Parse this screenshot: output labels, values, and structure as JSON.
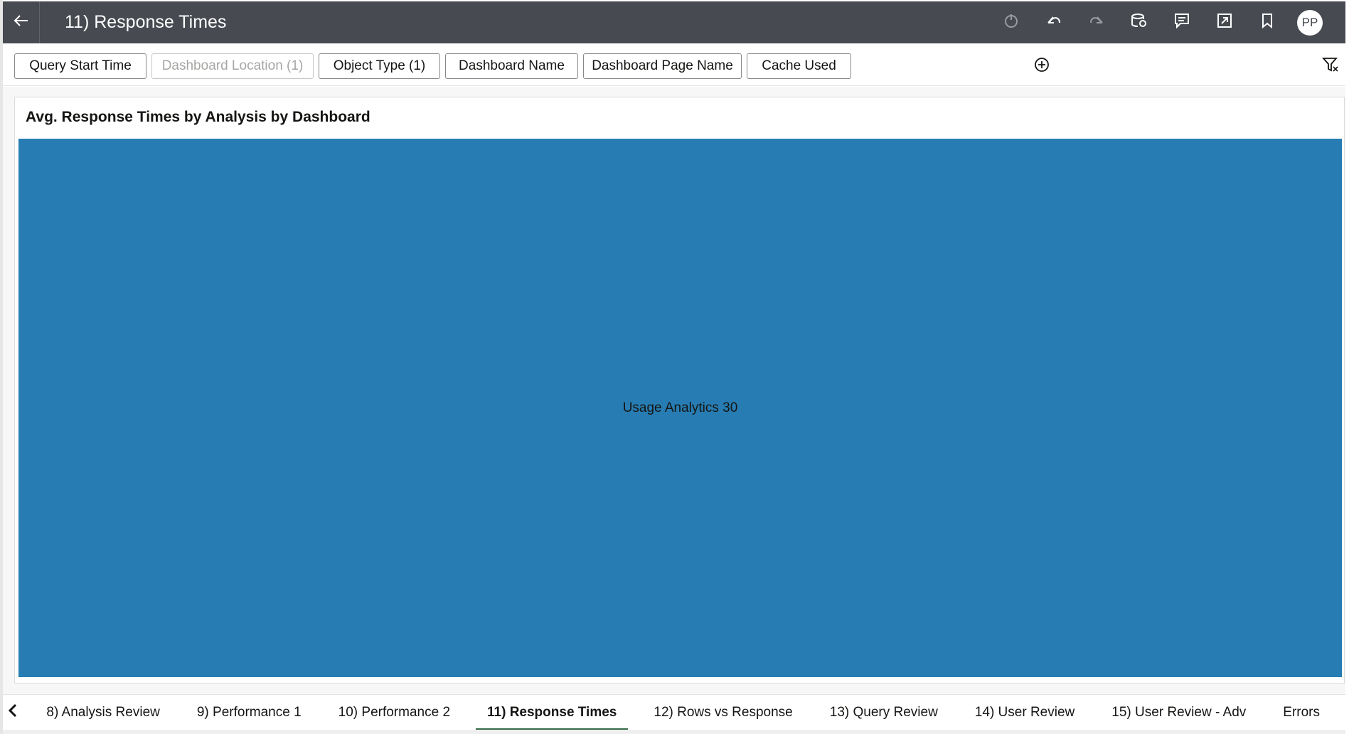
{
  "header": {
    "back_icon": "arrow-left-icon",
    "title": "11) Response Times",
    "actions": [
      {
        "name": "refresh-icon",
        "disabled": true
      },
      {
        "name": "undo-icon",
        "disabled": false
      },
      {
        "name": "redo-icon",
        "disabled": true
      },
      {
        "name": "data-refresh-icon",
        "disabled": false
      },
      {
        "name": "comments-icon",
        "disabled": false
      },
      {
        "name": "present-icon",
        "disabled": false
      },
      {
        "name": "bookmark-icon",
        "disabled": false
      }
    ],
    "avatar_initials": "PP"
  },
  "filters": {
    "pills": [
      {
        "label": "Query Start Time",
        "disabled": false
      },
      {
        "label": "Dashboard Location (1)",
        "disabled": true
      },
      {
        "label": "Object Type (1)",
        "disabled": false
      },
      {
        "label": "Dashboard Name",
        "disabled": false
      },
      {
        "label": "Dashboard Page Name",
        "disabled": false
      },
      {
        "label": "Cache Used",
        "disabled": false
      }
    ],
    "add_icon": "add-circle-icon",
    "toggle_icon": "filter-icon"
  },
  "visualization": {
    "title": "Avg. Response Times by Analysis by Dashboard",
    "tile_label": "Usage Analytics 30",
    "tile_color": "#277db3"
  },
  "chart_data": {
    "type": "treemap",
    "title": "Avg. Response Times by Analysis by Dashboard",
    "categories": [
      "Usage Analytics"
    ],
    "values": [
      30
    ],
    "colors": [
      "#277db3"
    ]
  },
  "tabs": {
    "prev_icon": "chevron-left-icon",
    "items": [
      {
        "label": "8) Analysis Review",
        "active": false
      },
      {
        "label": "9) Performance 1",
        "active": false
      },
      {
        "label": "10) Performance 2",
        "active": false
      },
      {
        "label": "11) Response Times",
        "active": true
      },
      {
        "label": "12) Rows vs Response",
        "active": false
      },
      {
        "label": "13) Query Review",
        "active": false
      },
      {
        "label": "14) User Review",
        "active": false
      },
      {
        "label": "15) User Review - Adv",
        "active": false
      },
      {
        "label": "Errors",
        "active": false
      }
    ],
    "active_color": "#356b47"
  }
}
